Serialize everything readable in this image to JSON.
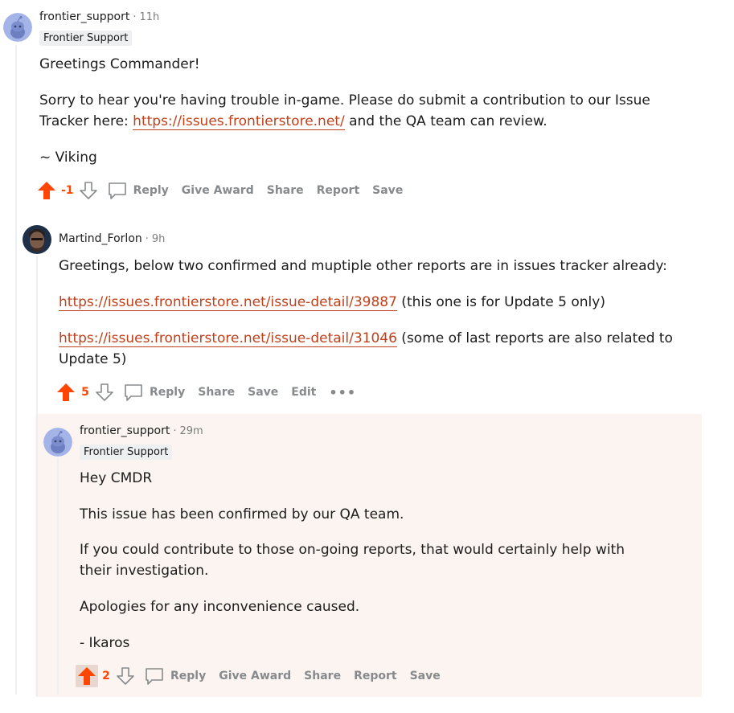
{
  "colors": {
    "accent": "#ff4500",
    "link": "#c0401a",
    "muted": "#878a8c",
    "highlight_bg": "#fbf4f1"
  },
  "comments": [
    {
      "author": "frontier_support",
      "time": "11h",
      "flair": "Frontier Support",
      "avatar_icon": "reddit-snoo-avatar-icon",
      "paragraphs": [
        {
          "text": "Greetings Commander!"
        },
        {
          "before": "Sorry to hear you're having trouble in-game. Please do submit a contribution to our Issue Tracker here: ",
          "link": "https://issues.frontierstore.net/",
          "after": " and the QA team can review."
        },
        {
          "text": "~ Viking"
        }
      ],
      "score": "-1",
      "actions": {
        "reply": "Reply",
        "give_award": "Give Award",
        "share": "Share",
        "report": "Report",
        "save": "Save"
      }
    },
    {
      "author": "Martind_Forlon",
      "time": "9h",
      "avatar_icon": "user-photo-avatar-icon",
      "paragraphs": [
        {
          "text": "Greetings, below two confirmed and muptiple other reports are in issues tracker already:"
        },
        {
          "link": "https://issues.frontierstore.net/issue-detail/39887",
          "after": " (this one is for Update 5 only)"
        },
        {
          "link": "https://issues.frontierstore.net/issue-detail/31046",
          "after": " (some of last reports are also related to Update 5)"
        }
      ],
      "score": "5",
      "actions": {
        "reply": "Reply",
        "share": "Share",
        "save": "Save",
        "edit": "Edit",
        "more": "•••"
      }
    },
    {
      "author": "frontier_support",
      "time": "29m",
      "flair": "Frontier Support",
      "avatar_icon": "reddit-snoo-avatar-icon",
      "paragraphs": [
        {
          "text": "Hey CMDR"
        },
        {
          "text": "This issue has been confirmed by our QA team."
        },
        {
          "text": "If you could contribute to those on-going reports, that would certainly help with their investigation."
        },
        {
          "text": "Apologies for any inconvenience caused."
        },
        {
          "text": "- Ikaros"
        }
      ],
      "score": "2",
      "actions": {
        "reply": "Reply",
        "give_award": "Give Award",
        "share": "Share",
        "report": "Report",
        "save": "Save"
      }
    }
  ]
}
